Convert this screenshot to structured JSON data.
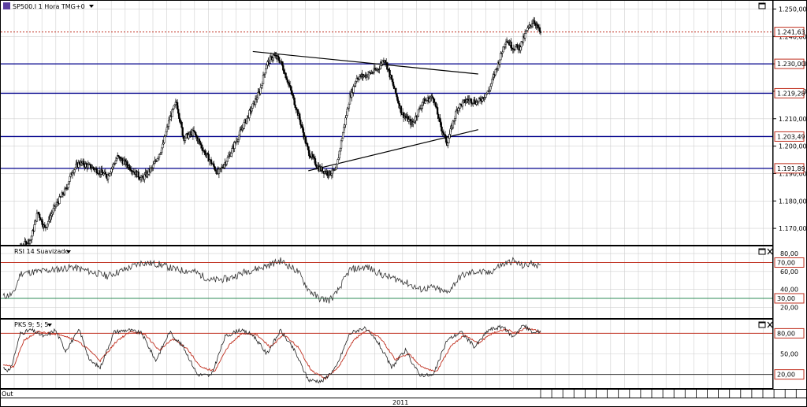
{
  "main_panel": {
    "title": "SP500.I 1 Hora TMG+0",
    "y_ticks": [
      "1.250,00",
      "1.240,00",
      "1.230,00",
      "1.220,00",
      "1.210,00",
      "1.200,00",
      "1.190,00",
      "1.180,00",
      "1.170,00"
    ],
    "level_labels": [
      {
        "value": 1241.63,
        "text": "1.241,63",
        "color": "#c03020"
      },
      {
        "value": 1230.0,
        "text": "1.230,00",
        "color": "#c03020"
      },
      {
        "value": 1219.28,
        "text": "1.219,28",
        "color": "#c03020"
      },
      {
        "value": 1203.49,
        "text": "1.203,49",
        "color": "#c03020"
      },
      {
        "value": 1191.89,
        "text": "1.191,89",
        "color": "#c03020"
      }
    ]
  },
  "rsi_panel": {
    "title": "RSI 14 Suavizado",
    "y_ticks": [
      "80,00",
      "60,00",
      "40,00",
      "20,00"
    ],
    "level_labels": [
      {
        "value": 70,
        "text": "70,00",
        "color": "#c03020"
      },
      {
        "value": 30,
        "text": "30,00",
        "color": "#c03020"
      }
    ]
  },
  "pks_panel": {
    "title": "PKS 9; 5; 5",
    "y_ticks": [
      "50,00"
    ],
    "level_labels": [
      {
        "value": 80,
        "text": "80,00",
        "color": "#c03020"
      },
      {
        "value": 20,
        "text": "20,00",
        "color": "#c03020"
      }
    ]
  },
  "x_axis": {
    "labels": [
      {
        "text": "Out",
        "pos": 0.0
      },
      {
        "text": "2011",
        "pos": 0.5
      }
    ]
  },
  "colors": {
    "candle": "#000000",
    "support_line": "#00008b",
    "trend_line": "#000000",
    "last_price_line": "#c03020",
    "rsi_line": "#333333",
    "rsi_upper": "#c03020",
    "rsi_lower": "#2e8b57",
    "pks_k": "#222222",
    "pks_d": "#c03020",
    "grid": "#d0d0d0"
  },
  "chart_data": {
    "type": "candlestick",
    "ylim": [
      1164,
      1253
    ],
    "price_path": [
      [
        0,
        1158
      ],
      [
        5,
        1163
      ],
      [
        8,
        1166
      ],
      [
        10,
        1176
      ],
      [
        12,
        1170
      ],
      [
        15,
        1178
      ],
      [
        18,
        1184
      ],
      [
        20,
        1191
      ],
      [
        22,
        1194
      ],
      [
        26,
        1192
      ],
      [
        30,
        1189
      ],
      [
        33,
        1196
      ],
      [
        36,
        1193
      ],
      [
        40,
        1188
      ],
      [
        43,
        1192
      ],
      [
        46,
        1200
      ],
      [
        48,
        1210
      ],
      [
        50,
        1216
      ],
      [
        52,
        1203
      ],
      [
        55,
        1205
      ],
      [
        58,
        1198
      ],
      [
        62,
        1190
      ],
      [
        65,
        1196
      ],
      [
        68,
        1204
      ],
      [
        71,
        1212
      ],
      [
        74,
        1220
      ],
      [
        76,
        1230
      ],
      [
        78,
        1233
      ],
      [
        80,
        1231
      ],
      [
        82,
        1224
      ],
      [
        85,
        1212
      ],
      [
        88,
        1198
      ],
      [
        91,
        1192
      ],
      [
        94,
        1190
      ],
      [
        96,
        1191
      ],
      [
        98,
        1205
      ],
      [
        100,
        1218
      ],
      [
        102,
        1225
      ],
      [
        105,
        1226
      ],
      [
        108,
        1228
      ],
      [
        110,
        1232
      ],
      [
        112,
        1224
      ],
      [
        115,
        1212
      ],
      [
        118,
        1208
      ],
      [
        121,
        1216
      ],
      [
        124,
        1218
      ],
      [
        126,
        1208
      ],
      [
        128,
        1201
      ],
      [
        131,
        1214
      ],
      [
        134,
        1217
      ],
      [
        137,
        1216
      ],
      [
        140,
        1220
      ],
      [
        143,
        1231
      ],
      [
        145,
        1239
      ],
      [
        147,
        1236
      ],
      [
        149,
        1236
      ],
      [
        151,
        1242
      ],
      [
        153,
        1246
      ],
      [
        155,
        1241
      ]
    ],
    "horizontal_levels": [
      1230.0,
      1219.28,
      1203.49,
      1191.89
    ],
    "last_price": 1241.63,
    "trend_lines": [
      {
        "from": [
          72,
          1234.5
        ],
        "to": [
          137,
          1226.3
        ]
      },
      {
        "from": [
          88,
          1191.0
        ],
        "to": [
          137,
          1206.0
        ]
      }
    ],
    "rsi": {
      "ylim": [
        8,
        88
      ],
      "upper": 70,
      "lower": 30,
      "path": [
        [
          0,
          32
        ],
        [
          3,
          35
        ],
        [
          5,
          58
        ],
        [
          10,
          60
        ],
        [
          15,
          62
        ],
        [
          20,
          65
        ],
        [
          25,
          60
        ],
        [
          30,
          55
        ],
        [
          35,
          62
        ],
        [
          40,
          70
        ],
        [
          45,
          68
        ],
        [
          50,
          62
        ],
        [
          55,
          60
        ],
        [
          60,
          50
        ],
        [
          65,
          52
        ],
        [
          70,
          60
        ],
        [
          75,
          65
        ],
        [
          80,
          72
        ],
        [
          85,
          60
        ],
        [
          88,
          40
        ],
        [
          91,
          30
        ],
        [
          94,
          28
        ],
        [
          96,
          35
        ],
        [
          100,
          62
        ],
        [
          105,
          65
        ],
        [
          110,
          55
        ],
        [
          115,
          50
        ],
        [
          120,
          40
        ],
        [
          124,
          42
        ],
        [
          128,
          36
        ],
        [
          132,
          55
        ],
        [
          136,
          60
        ],
        [
          140,
          58
        ],
        [
          143,
          66
        ],
        [
          147,
          72
        ],
        [
          150,
          66
        ],
        [
          153,
          70
        ],
        [
          155,
          64
        ]
      ]
    },
    "pks": {
      "ylim": [
        0,
        100
      ],
      "upper": 80,
      "lower": 20,
      "k_path": [
        [
          0,
          30
        ],
        [
          2,
          25
        ],
        [
          5,
          80
        ],
        [
          8,
          85
        ],
        [
          12,
          75
        ],
        [
          15,
          85
        ],
        [
          18,
          55
        ],
        [
          22,
          85
        ],
        [
          25,
          40
        ],
        [
          28,
          30
        ],
        [
          32,
          82
        ],
        [
          36,
          85
        ],
        [
          40,
          80
        ],
        [
          44,
          40
        ],
        [
          48,
          82
        ],
        [
          52,
          60
        ],
        [
          56,
          20
        ],
        [
          60,
          18
        ],
        [
          64,
          75
        ],
        [
          68,
          85
        ],
        [
          72,
          78
        ],
        [
          76,
          50
        ],
        [
          80,
          84
        ],
        [
          84,
          55
        ],
        [
          88,
          12
        ],
        [
          92,
          10
        ],
        [
          96,
          30
        ],
        [
          100,
          80
        ],
        [
          104,
          88
        ],
        [
          108,
          68
        ],
        [
          112,
          30
        ],
        [
          116,
          55
        ],
        [
          120,
          20
        ],
        [
          124,
          18
        ],
        [
          128,
          70
        ],
        [
          132,
          82
        ],
        [
          136,
          60
        ],
        [
          140,
          85
        ],
        [
          144,
          90
        ],
        [
          147,
          75
        ],
        [
          150,
          92
        ],
        [
          153,
          80
        ],
        [
          155,
          84
        ]
      ],
      "d_path": [
        [
          0,
          35
        ],
        [
          3,
          30
        ],
        [
          6,
          70
        ],
        [
          10,
          82
        ],
        [
          14,
          80
        ],
        [
          17,
          78
        ],
        [
          21,
          70
        ],
        [
          25,
          55
        ],
        [
          28,
          40
        ],
        [
          33,
          70
        ],
        [
          37,
          83
        ],
        [
          41,
          78
        ],
        [
          45,
          55
        ],
        [
          49,
          72
        ],
        [
          53,
          58
        ],
        [
          57,
          30
        ],
        [
          61,
          25
        ],
        [
          65,
          62
        ],
        [
          69,
          80
        ],
        [
          73,
          78
        ],
        [
          77,
          60
        ],
        [
          81,
          78
        ],
        [
          85,
          60
        ],
        [
          89,
          25
        ],
        [
          93,
          14
        ],
        [
          97,
          32
        ],
        [
          101,
          70
        ],
        [
          105,
          85
        ],
        [
          109,
          72
        ],
        [
          113,
          42
        ],
        [
          117,
          50
        ],
        [
          121,
          30
        ],
        [
          125,
          24
        ],
        [
          129,
          60
        ],
        [
          133,
          78
        ],
        [
          137,
          65
        ],
        [
          141,
          80
        ],
        [
          145,
          86
        ],
        [
          148,
          80
        ],
        [
          151,
          88
        ],
        [
          155,
          82
        ]
      ]
    }
  }
}
